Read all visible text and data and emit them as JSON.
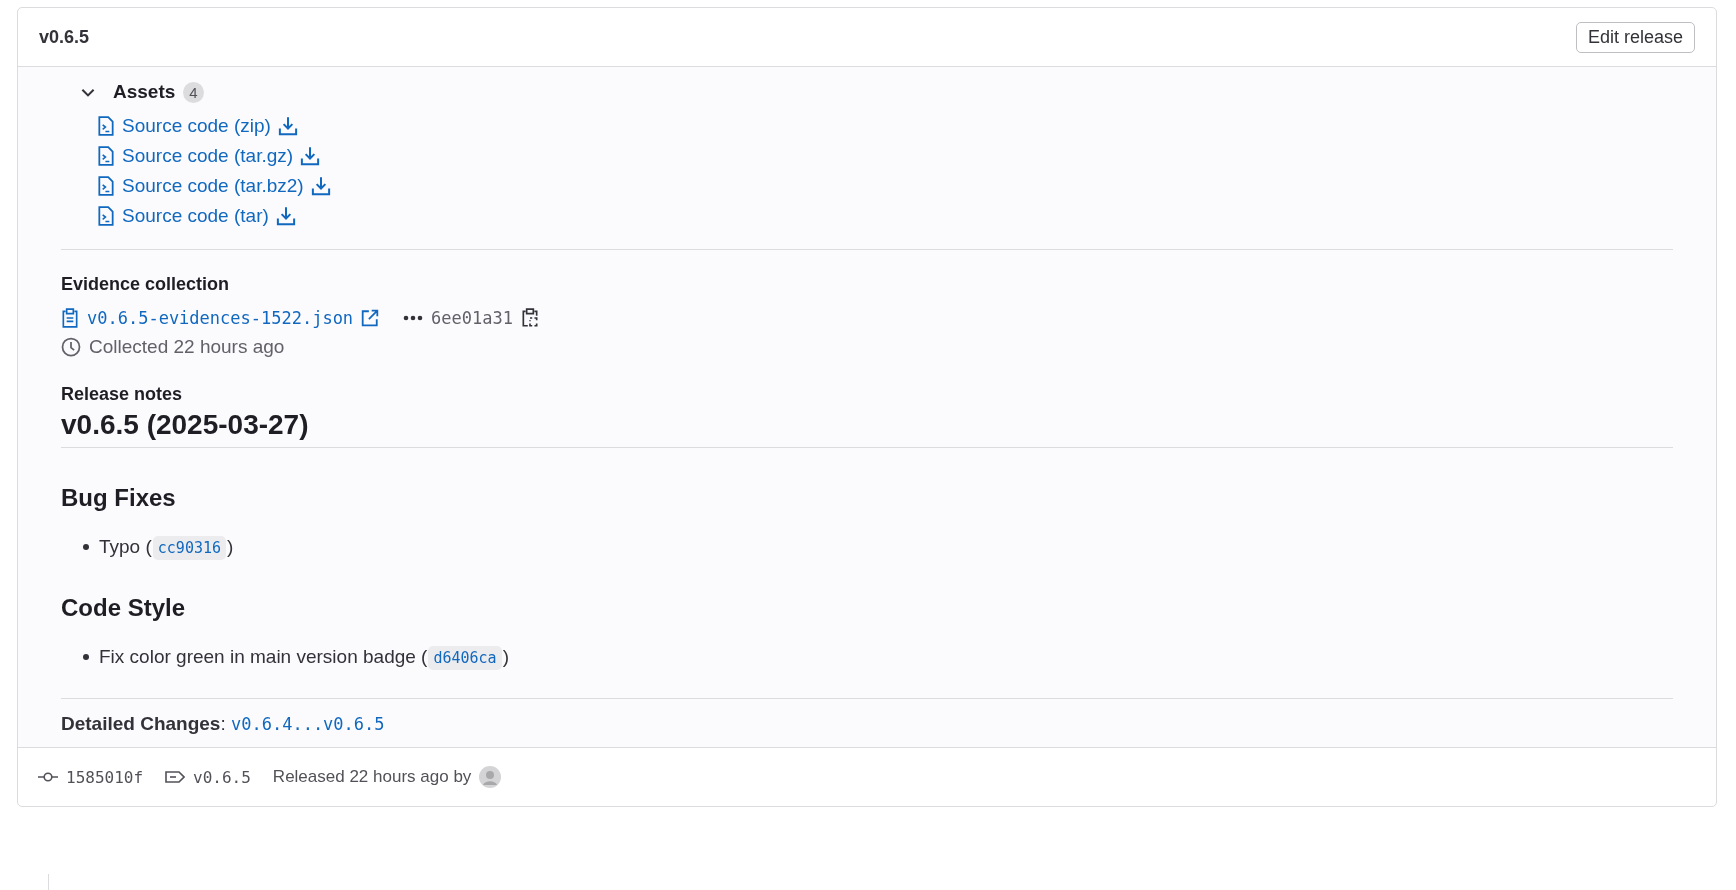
{
  "release": {
    "title": "v0.6.5",
    "edit_button": "Edit release"
  },
  "assets": {
    "label": "Assets",
    "count": "4",
    "expanded": true,
    "items": [
      {
        "label": "Source code (zip)"
      },
      {
        "label": "Source code (tar.gz)"
      },
      {
        "label": "Source code (tar.bz2)"
      },
      {
        "label": "Source code (tar)"
      }
    ]
  },
  "evidence": {
    "heading": "Evidence collection",
    "file": "v0.6.5-evidences-1522.json",
    "sha": "6ee01a31",
    "collected": "Collected 22 hours ago"
  },
  "notes": {
    "heading": "Release notes",
    "blocks": [
      {
        "kind": "h1",
        "text": "v0.6.5 (2025-03-27)"
      },
      {
        "kind": "h2",
        "text": "Bug Fixes"
      },
      {
        "kind": "bullet",
        "text": "Typo (",
        "code": "cc90316",
        "after": ")"
      },
      {
        "kind": "h2",
        "text": "Code Style"
      },
      {
        "kind": "bullet",
        "text": "Fix color green in main version badge (",
        "code": "d6406ca",
        "after": ")"
      },
      {
        "kind": "rule"
      },
      {
        "kind": "changes",
        "text": "**Detailed Changes**:",
        "link": "v0.6.4...v0.6.5"
      }
    ]
  },
  "footer": {
    "commit": "1585010f",
    "tag": "v0.6.5",
    "released": "Released 22 hours ago by"
  }
}
